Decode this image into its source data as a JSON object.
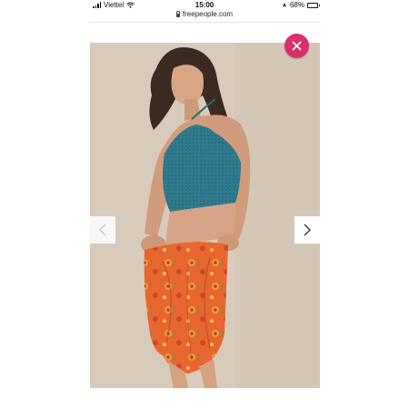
{
  "status_bar": {
    "carrier": "Viettel",
    "time": "15:00",
    "battery_percent": "68%",
    "battery_level": 0.68,
    "icons": [
      "signal-icon",
      "wifi-icon",
      "location-icon",
      "battery-icon"
    ]
  },
  "browser": {
    "url": "freepeople.com",
    "icon": "lock-icon"
  },
  "gallery": {
    "image_alt": "product-photo",
    "close_icon": "close-icon",
    "prev_icon": "chevron-left-icon",
    "next_icon": "chevron-right-icon"
  },
  "colors": {
    "accent": "#d6316d",
    "background": "#d8cbbb",
    "top": "#2f7b8e",
    "skirt": "#e8672f"
  }
}
